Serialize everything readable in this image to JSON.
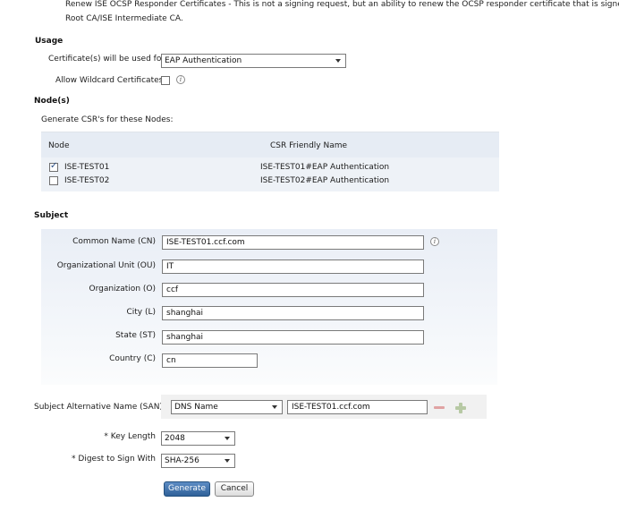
{
  "intro": {
    "line1": "Renew ISE OCSP Responder Certificates - This is not a signing request, but an ability to renew the OCSP responder certificate that is signed by the",
    "line2": "Root CA/ISE Intermediate CA."
  },
  "usage": {
    "title": "Usage",
    "used_for_label": "Certificate(s) will be used for",
    "used_for_value": "EAP Authentication",
    "wildcard_label": "Allow Wildcard Certificates"
  },
  "nodes": {
    "title": "Node(s)",
    "subtitle": "Generate CSR's for these Nodes:",
    "col_node": "Node",
    "col_csr": "CSR Friendly Name",
    "rows": [
      {
        "checked": true,
        "node": "ISE-TEST01",
        "csr": "ISE-TEST01#EAP Authentication"
      },
      {
        "checked": false,
        "node": "ISE-TEST02",
        "csr": "ISE-TEST02#EAP Authentication"
      }
    ]
  },
  "subject": {
    "title": "Subject",
    "fields": [
      {
        "label": "Common Name (CN)",
        "value": "ISE-TEST01.ccf.com"
      },
      {
        "label": "Organizational Unit (OU)",
        "value": "IT"
      },
      {
        "label": "Organization (O)",
        "value": "ccf"
      },
      {
        "label": "City (L)",
        "value": "shanghai"
      },
      {
        "label": "State (ST)",
        "value": "shanghai"
      },
      {
        "label": "Country (C)",
        "value": "cn"
      }
    ]
  },
  "san": {
    "label": "Subject Alternative Name (SAN)",
    "type_value": "DNS Name",
    "value": "ISE-TEST01.ccf.com"
  },
  "key_length": {
    "label": "* Key Length",
    "value": "2048"
  },
  "digest": {
    "label": "* Digest to Sign With",
    "value": "SHA-256"
  },
  "buttons": {
    "generate": "Generate",
    "cancel": "Cancel"
  },
  "icons": {
    "info": "i",
    "checkmark": "✓",
    "bullet": "•"
  }
}
